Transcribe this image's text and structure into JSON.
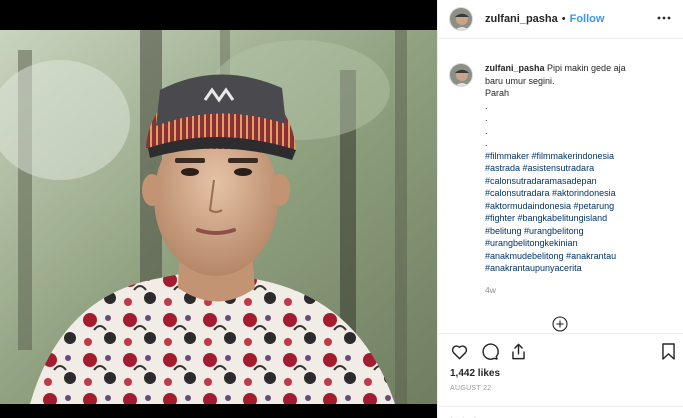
{
  "post": {
    "username": "zulfani_pasha",
    "separator": "•",
    "follow_label": "Follow",
    "caption_lines": [
      "Pipi makin gede aja",
      "baru umur segini.",
      "Parah",
      ".",
      ".",
      ".",
      "."
    ],
    "hashtag_lines": [
      "#filmmaker #filmmakerindonesia",
      "#astrada #asistensutradara",
      "#calonsutradaramasadepan",
      "#calonsutradara #aktorindonesia",
      "#aktormudaindonesia #petarung",
      "#fighter #bangkabelitungisland",
      "#belitung #urangbelitong",
      "#urangbelitongkekinian",
      "#anakmudebelitong #anakrantau",
      "#anakrantaupunyacerita"
    ],
    "time_ago": "4w",
    "likes": "1,442 likes",
    "date": "AUGUST 22",
    "bottom_hint": "• • •"
  },
  "icons": {
    "more": "more-horizontal-icon",
    "load_more": "plus-circle-icon",
    "like": "heart-icon",
    "comment": "comment-icon",
    "share": "share-icon",
    "save": "bookmark-icon"
  },
  "colors": {
    "link_blue": "#3897f0",
    "hashtag_blue": "#003569",
    "text": "#262626",
    "muted": "#8e8e8e",
    "divider": "#efefef"
  }
}
